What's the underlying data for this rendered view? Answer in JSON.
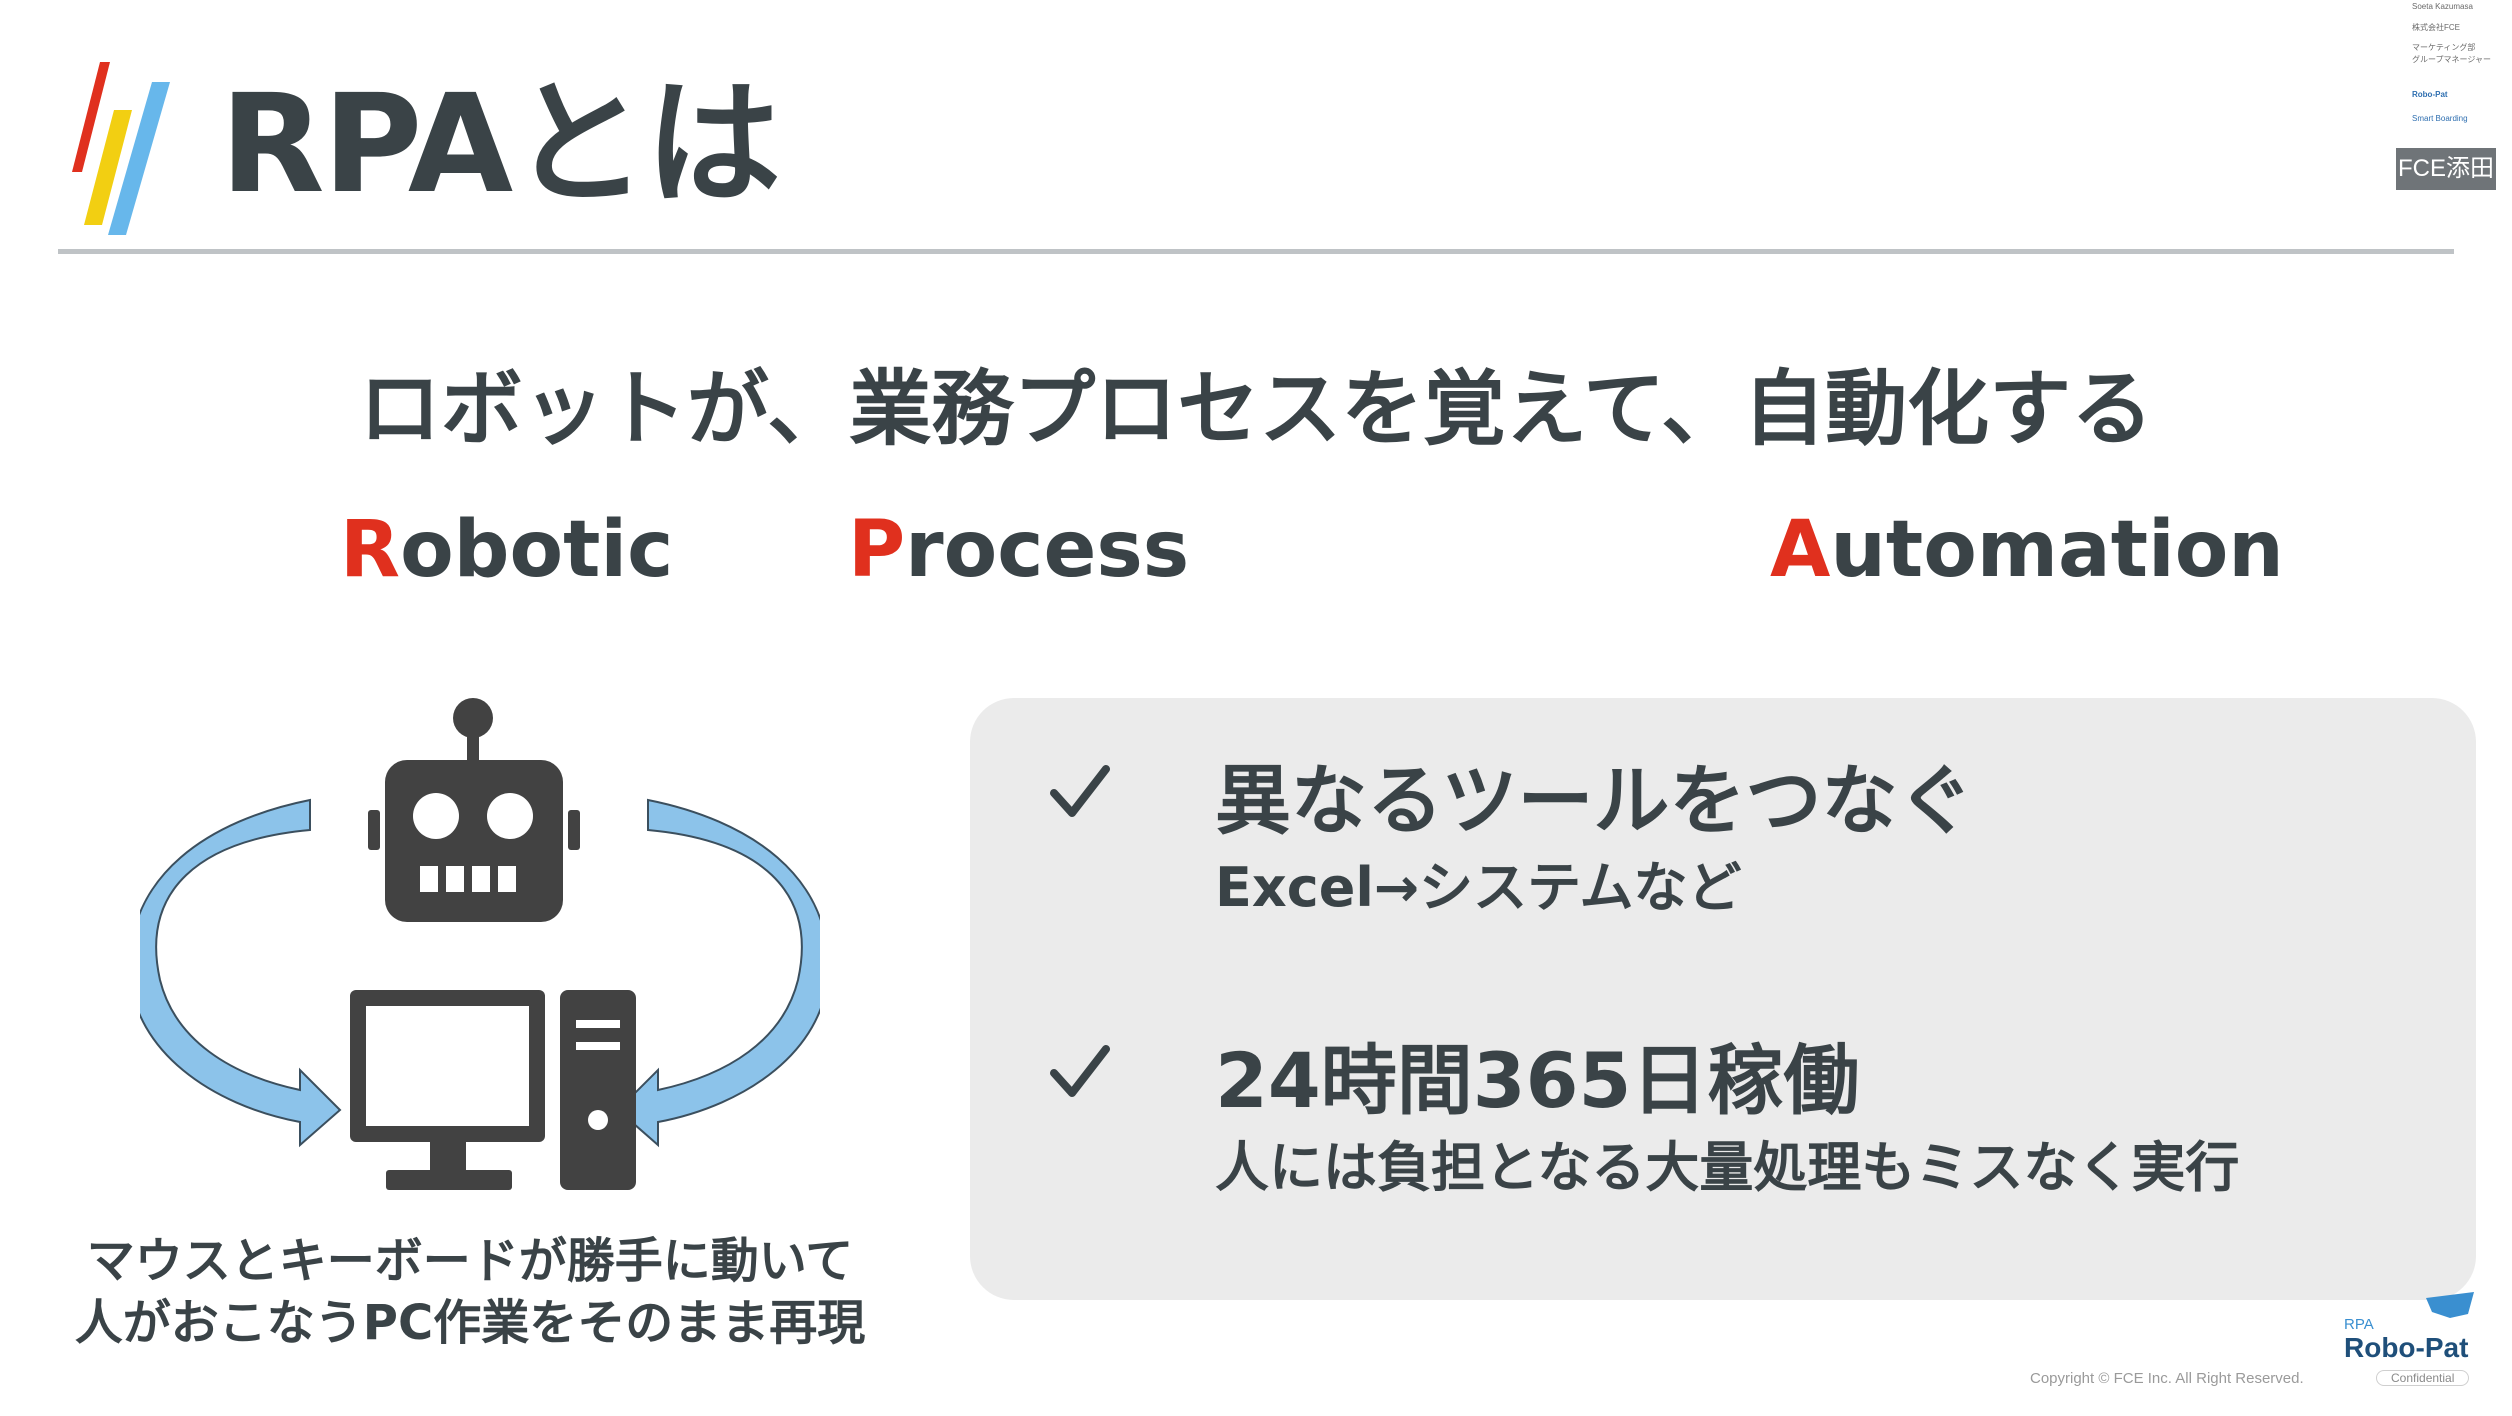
{
  "slide": {
    "title": "RPAとは",
    "headline": "ロボットが、業務プロセスを覚えて、自動化する",
    "acronym": [
      {
        "initial": "R",
        "rest": "obotic"
      },
      {
        "initial": "P",
        "rest": "rocess"
      },
      {
        "initial": "A",
        "rest": "utomation"
      }
    ],
    "robot_caption": [
      "マウスとキーボードが勝手に動いて",
      "人がおこなうPC作業をそのまま再現"
    ],
    "features": [
      {
        "title": "異なるツールをつなぐ",
        "subtitle": "Excel→システムなど"
      },
      {
        "title": "24時間365日稼働",
        "subtitle": "人には負担となる大量処理もミスなく実行"
      }
    ]
  },
  "presenter": {
    "name_label": "FCE添田",
    "header_lines": [
      "Soeta Kazumasa",
      "株式会社FCE",
      "マーケティング部",
      "グループマネージャー"
    ],
    "logos": [
      "Robo-Pat",
      "Smart Boarding"
    ]
  },
  "brand": {
    "small": "RPA",
    "name": "Robo-Pat"
  },
  "footer": {
    "copyright": "Copyright © FCE Inc. All Right Reserved.",
    "confidential": "Confidential"
  },
  "colors": {
    "accent_red": "#e0301e",
    "arrow_blue": "#8cc3ea",
    "logo_yellow": "#f2cf12",
    "logo_red": "#e0301e",
    "logo_blue": "#5fb3ea",
    "panel_gray": "#ebebeb",
    "text_dark": "#3a4347"
  },
  "icons": [
    "logo-bars-icon",
    "robot-icon",
    "computer-icon",
    "cycle-arrows-icon",
    "check-icon"
  ]
}
